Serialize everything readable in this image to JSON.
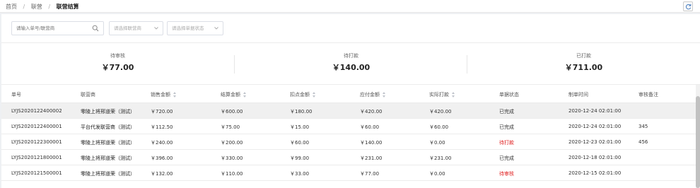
{
  "breadcrumb": {
    "home": "首页",
    "level2": "联营",
    "current": "联营结算"
  },
  "filters": {
    "search_placeholder": "请输入单号/联营商",
    "merchant_placeholder": "请选择联营商",
    "status_placeholder": "请选择单据状态"
  },
  "stats": [
    {
      "label": "待审核",
      "value": "￥77.00"
    },
    {
      "label": "待打款",
      "value": "￥140.00"
    },
    {
      "label": "已打款",
      "value": "￥711.00"
    }
  ],
  "table": {
    "headers": [
      "单号",
      "联营商",
      "销售金额",
      "结算金额",
      "扣点金额",
      "应付金额",
      "实际打款",
      "单据状态",
      "制单时间",
      "审核备注"
    ],
    "rows": [
      [
        "LYJS2020122400002",
        "零陵上将邢道荣（测试）",
        "￥720.00",
        "￥600.00",
        "￥180.00",
        "￥420.00",
        "￥420.00",
        "已完成",
        "2020-12-24 02:01:00",
        ""
      ],
      [
        "LYJS2020122400001",
        "平台代发联营商（测试）",
        "￥112.50",
        "￥75.00",
        "￥15.00",
        "￥60.00",
        "￥60.00",
        "已完成",
        "2020-12-24 02:01:00",
        "345"
      ],
      [
        "LYJS2020122300001",
        "零陵上将邢道荣（测试）",
        "￥240.00",
        "￥200.00",
        "￥60.00",
        "￥140.00",
        "￥0.00",
        "待打款",
        "2020-12-23 02:01:00",
        "456"
      ],
      [
        "LYJS2020121800001",
        "零陵上将邢道荣（测试）",
        "￥396.00",
        "￥330.00",
        "￥99.00",
        "￥231.00",
        "￥231.00",
        "已完成",
        "2020-12-18 02:01:00",
        ""
      ],
      [
        "LYJS2020121500001",
        "零陵上将邢道荣（测试）",
        "￥132.00",
        "￥110.00",
        "￥33.00",
        "￥77.00",
        "￥0.00",
        "待审核",
        "2020-12-15 02:01:00",
        ""
      ]
    ]
  },
  "colors": {
    "status_warning": "#e02020",
    "highlight_row": "#f0f0f0"
  },
  "icons": {
    "refresh": "refresh-icon",
    "search": "search-icon",
    "dropdown": "chevron-down-icon"
  }
}
